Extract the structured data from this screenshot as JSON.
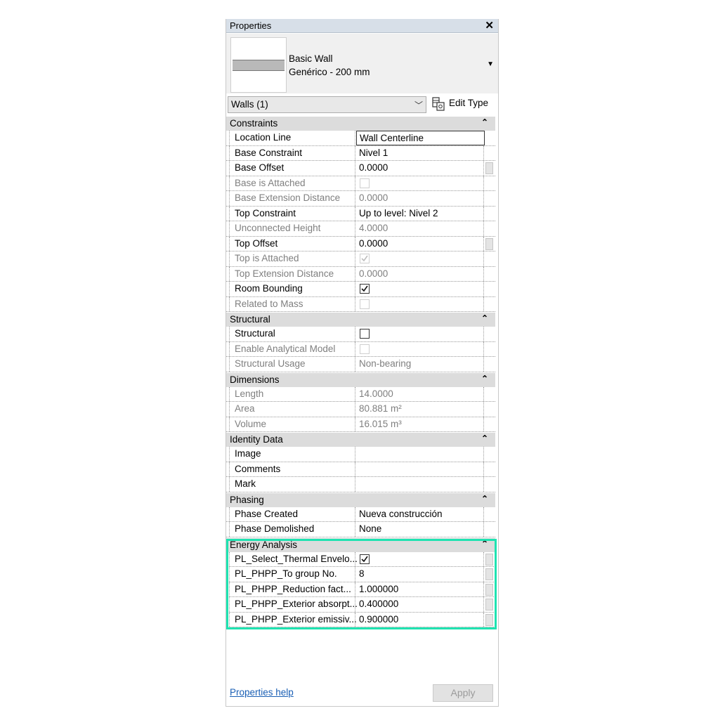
{
  "window": {
    "title": "Properties",
    "close_glyph": "✕"
  },
  "type_selector": {
    "line1": "Basic Wall",
    "line2": "Genérico - 200 mm",
    "dropdown_icon": "triangle-down-icon"
  },
  "filter": {
    "selected": "Walls (1)",
    "edit_type_label": "Edit Type"
  },
  "groups": [
    {
      "name": "Constraints",
      "rows": [
        {
          "label": "Location Line",
          "value": "Wall Centerline",
          "kind": "text",
          "disabled": false,
          "btn": false
        },
        {
          "label": "Base Constraint",
          "value": "Nivel 1",
          "kind": "text",
          "disabled": false,
          "btn": false
        },
        {
          "label": "Base Offset",
          "value": "0.0000",
          "kind": "text",
          "disabled": false,
          "btn": true
        },
        {
          "label": "Base is Attached",
          "value": "",
          "kind": "check",
          "checked": false,
          "disabled": true,
          "btn": false
        },
        {
          "label": "Base Extension Distance",
          "value": "0.0000",
          "kind": "text",
          "disabled": true,
          "btn": false
        },
        {
          "label": "Top Constraint",
          "value": "Up to level: Nivel 2",
          "kind": "text",
          "disabled": false,
          "btn": false
        },
        {
          "label": "Unconnected Height",
          "value": "4.0000",
          "kind": "text",
          "disabled": true,
          "btn": false
        },
        {
          "label": "Top Offset",
          "value": "0.0000",
          "kind": "text",
          "disabled": false,
          "btn": true
        },
        {
          "label": "Top is Attached",
          "value": "",
          "kind": "check",
          "checked": true,
          "disabled": true,
          "btn": false
        },
        {
          "label": "Top Extension Distance",
          "value": "0.0000",
          "kind": "text",
          "disabled": true,
          "btn": false
        },
        {
          "label": "Room Bounding",
          "value": "",
          "kind": "check",
          "checked": true,
          "disabled": false,
          "btn": false
        },
        {
          "label": "Related to Mass",
          "value": "",
          "kind": "check",
          "checked": false,
          "disabled": true,
          "btn": false
        }
      ]
    },
    {
      "name": "Structural",
      "rows": [
        {
          "label": "Structural",
          "value": "",
          "kind": "check",
          "checked": false,
          "disabled": false,
          "btn": false
        },
        {
          "label": "Enable Analytical Model",
          "value": "",
          "kind": "check",
          "checked": false,
          "disabled": true,
          "btn": false
        },
        {
          "label": "Structural Usage",
          "value": "Non-bearing",
          "kind": "text",
          "disabled": true,
          "btn": false
        }
      ]
    },
    {
      "name": "Dimensions",
      "rows": [
        {
          "label": "Length",
          "value": "14.0000",
          "kind": "text",
          "disabled": true,
          "btn": false
        },
        {
          "label": "Area",
          "value": "80.881 m²",
          "kind": "text",
          "disabled": true,
          "btn": false
        },
        {
          "label": "Volume",
          "value": "16.015 m³",
          "kind": "text",
          "disabled": true,
          "btn": false
        }
      ]
    },
    {
      "name": "Identity Data",
      "rows": [
        {
          "label": "Image",
          "value": "",
          "kind": "text",
          "disabled": false,
          "btn": false
        },
        {
          "label": "Comments",
          "value": "",
          "kind": "text",
          "disabled": false,
          "btn": false
        },
        {
          "label": "Mark",
          "value": "",
          "kind": "text",
          "disabled": false,
          "btn": false
        }
      ]
    },
    {
      "name": "Phasing",
      "rows": [
        {
          "label": "Phase Created",
          "value": "Nueva construcción",
          "kind": "text",
          "disabled": false,
          "btn": false
        },
        {
          "label": "Phase Demolished",
          "value": "None",
          "kind": "text",
          "disabled": false,
          "btn": false
        }
      ]
    },
    {
      "name": "Energy Analysis",
      "rows": [
        {
          "label": "PL_Select_Thermal Envelo...",
          "value": "",
          "kind": "check",
          "checked": true,
          "disabled": false,
          "btn": true
        },
        {
          "label": "PL_PHPP_To group No.",
          "value": "8",
          "kind": "text",
          "disabled": false,
          "btn": true
        },
        {
          "label": "PL_PHPP_Reduction fact...",
          "value": "1.000000",
          "kind": "text",
          "disabled": false,
          "btn": true
        },
        {
          "label": "PL_PHPP_Exterior absorpt...",
          "value": "0.400000",
          "kind": "text",
          "disabled": false,
          "btn": true
        },
        {
          "label": "PL_PHPP_Exterior emissiv...",
          "value": "0.900000",
          "kind": "text",
          "disabled": false,
          "btn": true
        }
      ]
    }
  ],
  "collapse_glyph": "⌃",
  "footer": {
    "help_link": "Properties help",
    "apply_label": "Apply"
  },
  "colors": {
    "highlight": "#1fe3b1",
    "group_bg": "#dcdcdc",
    "titlebar_bg": "#d7dfe8"
  }
}
